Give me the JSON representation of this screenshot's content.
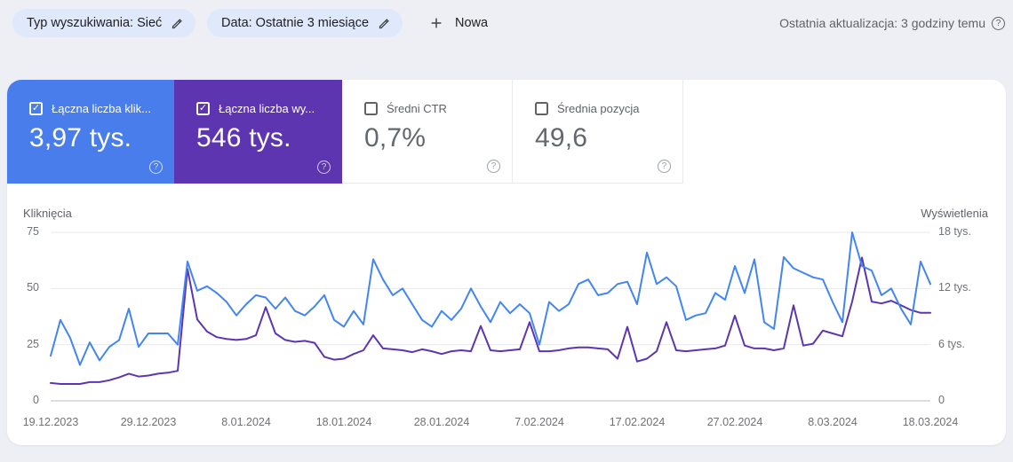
{
  "filters": {
    "search_type_label": "Typ wyszukiwania: Sieć",
    "date_range_label": "Data: Ostatnie 3 miesiące",
    "new_filter_label": "Nowa"
  },
  "header": {
    "last_update_text": "Ostatnia aktualizacja: 3 godziny temu",
    "help_glyph": "?"
  },
  "metrics": [
    {
      "label": "Łączna liczba klik...",
      "value": "3,97 tys.",
      "checked": true,
      "bg": "#4a7dec"
    },
    {
      "label": "Łączna liczba wy...",
      "value": "546 tys.",
      "checked": true,
      "bg": "#5e35b1"
    },
    {
      "label": "Średni CTR",
      "value": "0,7%",
      "checked": false,
      "bg": "#ffffff"
    },
    {
      "label": "Średnia pozycja",
      "value": "49,6",
      "checked": false,
      "bg": "#ffffff"
    }
  ],
  "chart_data": {
    "type": "line",
    "grid": true,
    "left_axis": {
      "title": "Kliknięcia",
      "tick_labels": [
        "0",
        "25",
        "50",
        "75"
      ],
      "range": [
        0,
        75
      ]
    },
    "right_axis": {
      "title": "Wyświetlenia",
      "tick_labels": [
        "0",
        "6 tys.",
        "12 tys.",
        "18 tys."
      ],
      "range_tys": [
        0,
        18
      ]
    },
    "x_tick_labels": [
      "19.12.2023",
      "29.12.2023",
      "8.01.2024",
      "18.01.2024",
      "28.01.2024",
      "7.02.2024",
      "17.02.2024",
      "27.02.2024",
      "8.03.2024",
      "18.03.2024"
    ],
    "series": [
      {
        "name": "Łączna liczba kliknięć",
        "axis": "left",
        "color": "#4285f4",
        "values": [
          20,
          36,
          28,
          16,
          26,
          18,
          24,
          27,
          41,
          24,
          30,
          30,
          30,
          25,
          62,
          49,
          51,
          48,
          44,
          38,
          43,
          47,
          46,
          41,
          46,
          40,
          38,
          42,
          47,
          36,
          33,
          40,
          34,
          63,
          54,
          47,
          50,
          43,
          36,
          33,
          40,
          36,
          41,
          50,
          42,
          35,
          44,
          39,
          43,
          39,
          25,
          44,
          40,
          43,
          52,
          54,
          47,
          48,
          52,
          53,
          43,
          66,
          52,
          55,
          51,
          36,
          38,
          39,
          48,
          45,
          60,
          48,
          63,
          35,
          32,
          64,
          59,
          57,
          55,
          54,
          44,
          35,
          75,
          60,
          58,
          47,
          50,
          41,
          34,
          62,
          52
        ]
      },
      {
        "name": "Łączna liczba wyświetleń",
        "axis": "right",
        "unit": "tys.",
        "color": "#5e35b1",
        "values": [
          1.9,
          1.8,
          1.8,
          1.8,
          2.0,
          2.0,
          2.2,
          2.5,
          2.9,
          2.6,
          2.7,
          2.9,
          3.0,
          3.2,
          14.1,
          8.7,
          7.4,
          6.8,
          6.6,
          6.5,
          6.6,
          7.0,
          10.0,
          7.2,
          6.5,
          6.3,
          6.4,
          6.2,
          4.7,
          4.4,
          4.5,
          5.0,
          5.4,
          7.0,
          5.6,
          5.5,
          5.4,
          5.2,
          5.5,
          5.3,
          5.0,
          5.3,
          5.4,
          5.3,
          8.0,
          5.4,
          5.3,
          5.4,
          5.5,
          8.4,
          5.3,
          5.3,
          5.4,
          5.6,
          5.7,
          5.7,
          5.6,
          5.5,
          4.5,
          7.9,
          4.2,
          4.5,
          5.3,
          8.4,
          5.4,
          5.3,
          5.4,
          5.5,
          5.6,
          5.9,
          9.1,
          5.9,
          5.6,
          5.6,
          5.4,
          5.6,
          10.2,
          5.9,
          6.1,
          7.5,
          7.2,
          6.9,
          10.6,
          15.3,
          10.6,
          10.4,
          10.7,
          10.2,
          9.7,
          9.4,
          9.4
        ]
      }
    ]
  },
  "colors": {
    "page_bg": "#edeff5",
    "chip_bg": "#dfe9fb",
    "clicks_blue": "#4285f4",
    "impressions_purple": "#5e35b1",
    "grid_line": "#e8eaed",
    "axis_line": "#c9cbcf",
    "text_grey": "#5f6368"
  },
  "glyphs": {
    "check": "✓",
    "plus": "+"
  }
}
